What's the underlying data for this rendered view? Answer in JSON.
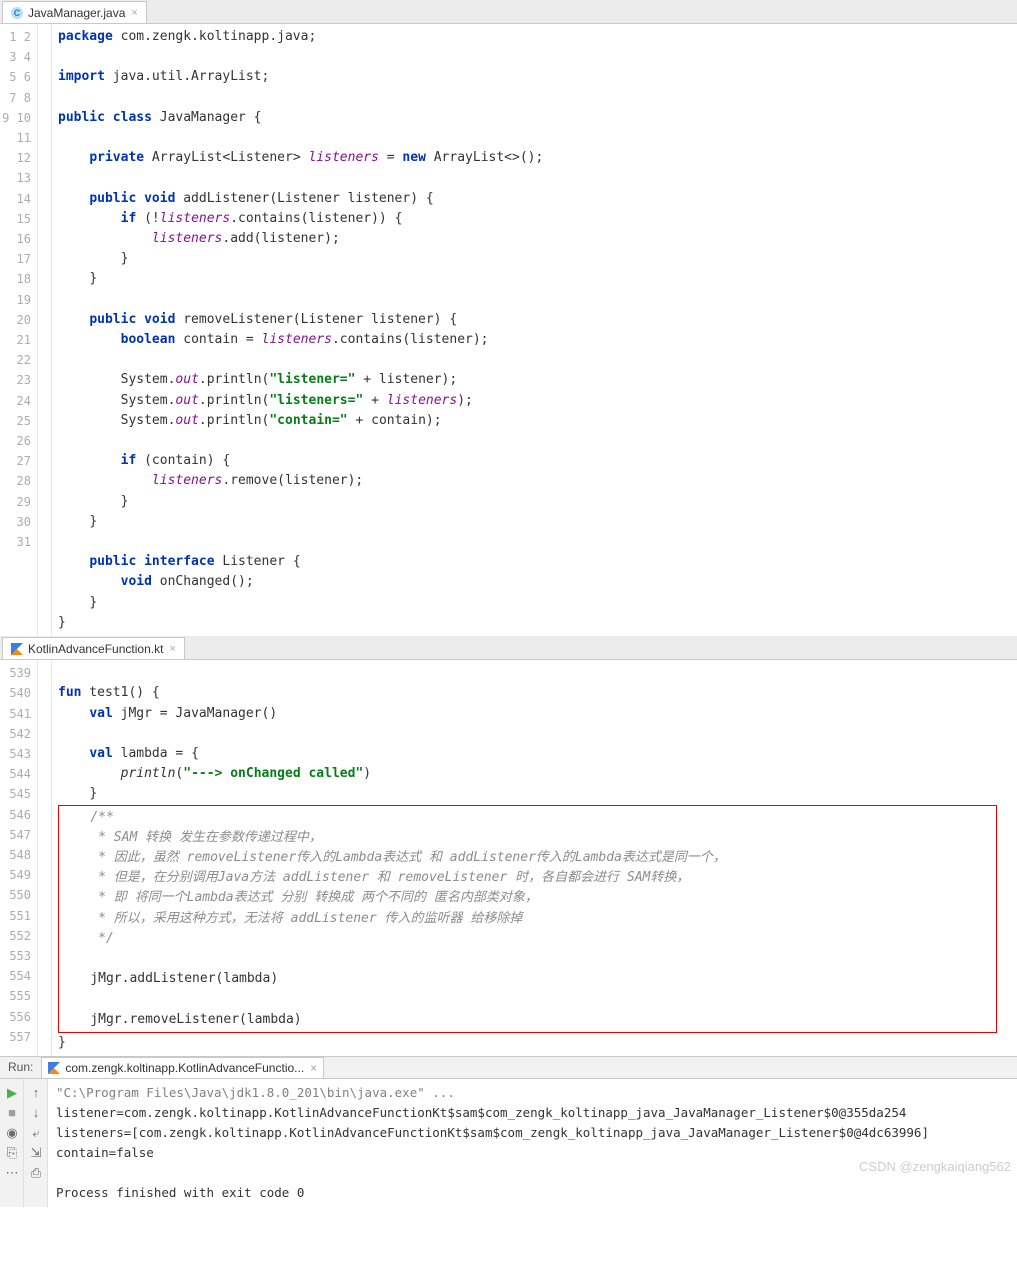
{
  "tab1": {
    "file": "JavaManager.java"
  },
  "editor1": {
    "lines": [
      "1",
      "2",
      "3",
      "4",
      "5",
      "6",
      "7",
      "8",
      "9",
      "10",
      "11",
      "12",
      "13",
      "14",
      "15",
      "16",
      "17",
      "18",
      "19",
      "20",
      "21",
      "22",
      "23",
      "24",
      "25",
      "26",
      "27",
      "28",
      "29",
      "30",
      "31"
    ],
    "pkg_line": {
      "kw1": "package",
      "rest": " com.zengk.koltinapp.java;"
    },
    "import_line": {
      "kw1": "import",
      "rest": " java.util.ArrayList;"
    },
    "class_line": {
      "kw1": "public class",
      "name": " JavaManager {"
    },
    "field_line": {
      "kw1": "private",
      "type": " ArrayList<Listener> ",
      "fname": "listeners",
      "eq": " = ",
      "kw2": "new",
      "rest": " ArrayList<>();"
    },
    "add1": {
      "kw1": "public void",
      "sig": " addListener(Listener listener) {"
    },
    "add2": {
      "kw1": "if",
      "a": " (!",
      "f": "listeners",
      "b": ".contains(listener)) {"
    },
    "add3": {
      "f": "listeners",
      "b": ".add(listener);"
    },
    "brace": "}",
    "rem1": {
      "kw1": "public void",
      "sig": " removeListener(Listener listener) {"
    },
    "rem2": {
      "kw1": "boolean",
      "a": " contain = ",
      "f": "listeners",
      "b": ".contains(listener);"
    },
    "p1a": "System.",
    "p1b": "out",
    "p1c": ".println(",
    "p1s": "\"listener=\"",
    "p1d": " + listener);",
    "p2s": "\"listeners=\"",
    "p2d": " + ",
    "p2f": "listeners",
    "p2e": ");",
    "p3s": "\"contain=\"",
    "p3d": " + contain);",
    "if2": {
      "kw1": "if",
      "a": " (contain) {"
    },
    "if2b": {
      "f": "listeners",
      "b": ".remove(listener);"
    },
    "iface": {
      "kw1": "public interface",
      "name": " Listener {"
    },
    "ifacem": {
      "kw1": "void",
      "name": " onChanged();"
    }
  },
  "tab2": {
    "file": "KotlinAdvanceFunction.kt"
  },
  "editor2": {
    "lines": [
      "",
      "539",
      "540",
      "541",
      "542",
      "543",
      "544",
      "545",
      "546",
      "547",
      "548",
      "549",
      "550",
      "551",
      "552",
      "553",
      "554",
      "555",
      "556",
      "557"
    ],
    "fun1": {
      "kw": "fun",
      "sig": " test1() {"
    },
    "val1": {
      "kw": "val",
      "a": " jMgr = JavaManager()"
    },
    "val2": {
      "kw": "val",
      "a": " lambda = {"
    },
    "pln": {
      "fn": "println",
      "a": "(",
      "s": "\"---> onChanged called\"",
      "b": ")"
    },
    "brace": "}",
    "c1": "/**",
    "c2": " * SAM 转换 发生在参数传递过程中，",
    "c3": " * 因此，虽然 removeListener传入的Lambda表达式 和 addListener传入的Lambda表达式是同一个，",
    "c4": " * 但是，在分别调用Java方法 addListener 和 removeListener 时，各自都会进行 SAM转换，",
    "c5": " * 即 将同一个Lambda表达式 分别 转换成 两个不同的 匿名内部类对象，",
    "c6": " * 所以，采用这种方式，无法将 addListener 传入的监听器 给移除掉",
    "c7": " */",
    "call1": "jMgr.addListener(lambda)",
    "call2": "jMgr.removeListener(lambda)"
  },
  "run": {
    "label": "Run:",
    "tab": "com.zengk.koltinapp.KotlinAdvanceFunctio...",
    "l1": "\"C:\\Program Files\\Java\\jdk1.8.0_201\\bin\\java.exe\" ...",
    "l2": "listener=com.zengk.koltinapp.KotlinAdvanceFunctionKt$sam$com_zengk_koltinapp_java_JavaManager_Listener$0@355da254",
    "l3": "listeners=[com.zengk.koltinapp.KotlinAdvanceFunctionKt$sam$com_zengk_koltinapp_java_JavaManager_Listener$0@4dc63996]",
    "l4": "contain=false",
    "l5": "Process finished with exit code 0"
  },
  "watermark": "CSDN @zengkaiqiang562"
}
